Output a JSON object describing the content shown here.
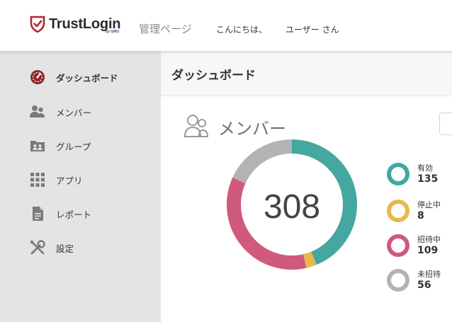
{
  "header": {
    "brand": "TrustLogin",
    "brand_sub": "by GMO",
    "admin_link": "管理ページ",
    "greeting": "こんにちは、",
    "username": "ユーザー さん"
  },
  "sidebar": {
    "items": [
      {
        "label": "ダッシュボード",
        "icon": "dashboard-icon",
        "active": true
      },
      {
        "label": "メンバー",
        "icon": "members-icon",
        "active": false
      },
      {
        "label": "グループ",
        "icon": "group-icon",
        "active": false
      },
      {
        "label": "アプリ",
        "icon": "apps-grid-icon",
        "active": false
      },
      {
        "label": "レポート",
        "icon": "report-icon",
        "active": false
      },
      {
        "label": "設定",
        "icon": "settings-tools-icon",
        "active": false
      }
    ]
  },
  "main": {
    "page_title": "ダッシュボード",
    "card": {
      "title": "メンバー",
      "icon": "members-outline-icon",
      "total": "308",
      "segments": [
        {
          "label": "有効",
          "value": 135,
          "color": "#44a7a0"
        },
        {
          "label": "停止中",
          "value": 8,
          "color": "#e8b84a"
        },
        {
          "label": "招待中",
          "value": 109,
          "color": "#cf5a7b"
        },
        {
          "label": "未招待",
          "value": 56,
          "color": "#b3b3b3"
        }
      ]
    }
  }
}
